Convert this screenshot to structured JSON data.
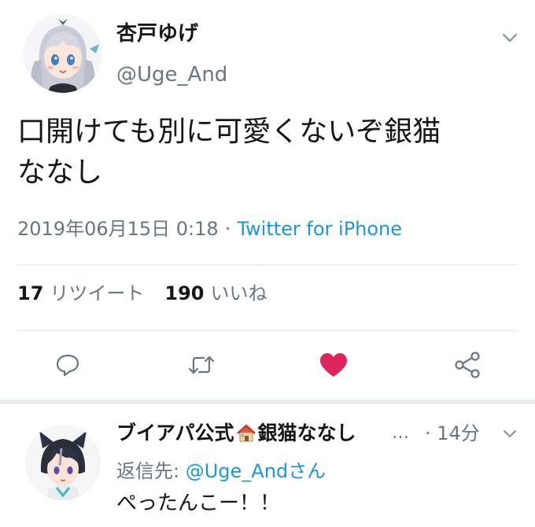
{
  "tweet": {
    "display_name": "杏戸ゆげ",
    "handle": "@Uge_And",
    "text": "口開けても別に可愛くないぞ銀猫\nななし",
    "timestamp": "2019年06月15日 0:18",
    "separator": "·",
    "source": "Twitter for iPhone",
    "retweets_count": "17",
    "retweets_label": "リツイート",
    "likes_count": "190",
    "likes_label": "いいね",
    "liked": true,
    "like_color": "#e0245e"
  },
  "reply": {
    "display_name_prefix": "ブイアパ公式",
    "display_name_suffix": "銀猫ななし",
    "ellipsis": "…",
    "time": "· 14分",
    "replying_prefix": "返信先: ",
    "replying_mention": "@Uge_And",
    "replying_suffix": "さん",
    "text": "ぺったんこー！！"
  },
  "icons": {
    "caret": "chevron-down-icon",
    "reply": "reply-icon",
    "retweet": "retweet-icon",
    "like": "heart-icon",
    "share": "share-icon",
    "house": "house-emoji-icon"
  },
  "colors": {
    "text_primary": "#14171a",
    "text_secondary": "#657786",
    "link": "#1b95e0",
    "divider": "#e1e8ed"
  }
}
